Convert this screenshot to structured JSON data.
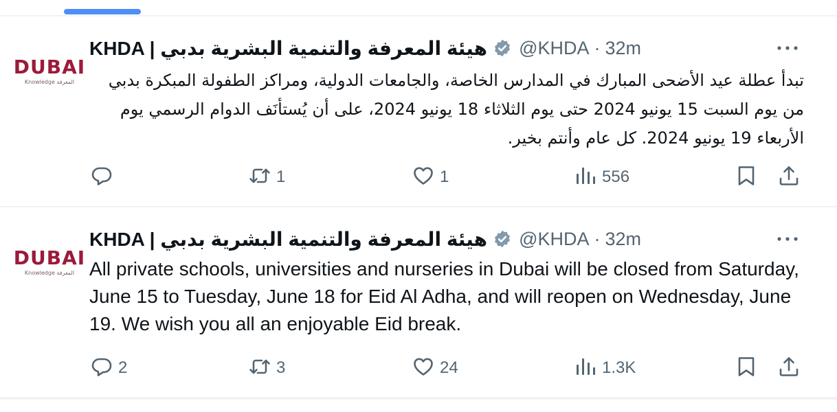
{
  "feed": {
    "tweets": [
      {
        "avatar": {
          "logo_text": "DUBAI",
          "logo_subtext": "Knowledge المعرفة"
        },
        "author_name": "KHDA | هيئة المعرفة والتنمية البشرية بدبي",
        "handle": "@KHDA",
        "separator": "·",
        "time": "32m",
        "text": "تبدأ عطلة عيد الأضحى المبارك في المدارس الخاصة، والجامعات الدولية، ومراكز الطفولة المبكرة بدبي من يوم السبت 15 يونيو 2024 حتى يوم الثلاثاء 18 يونيو 2024، على أن يُستأنَف الدوام الرسمي يوم الأربعاء 19 يونيو 2024. كل عام وأنتم بخير.",
        "replies": "",
        "reposts": "1",
        "likes": "1",
        "views": "556"
      },
      {
        "avatar": {
          "logo_text": "DUBAI",
          "logo_subtext": "Knowledge المعرفة"
        },
        "author_name": "KHDA | هيئة المعرفة والتنمية البشرية بدبي",
        "handle": "@KHDA",
        "separator": "·",
        "time": "32m",
        "text": "All private schools, universities and nurseries in Dubai will be closed from Saturday, June 15 to Tuesday, June 18 for Eid Al Adha, and will reopen on Wednesday, June 19. We wish you all an enjoyable Eid break.",
        "replies": "2",
        "reposts": "3",
        "likes": "24",
        "views": "1.3K"
      }
    ]
  },
  "colors": {
    "accent": "#4f8ef7",
    "brand": "#9b1b3a",
    "verified": "#829aab",
    "muted": "#536471",
    "border": "#eff3f4"
  },
  "icons": [
    "reply-icon",
    "repost-icon",
    "like-icon",
    "views-icon",
    "bookmark-icon",
    "share-icon",
    "more-icon",
    "verified-badge-icon"
  ]
}
